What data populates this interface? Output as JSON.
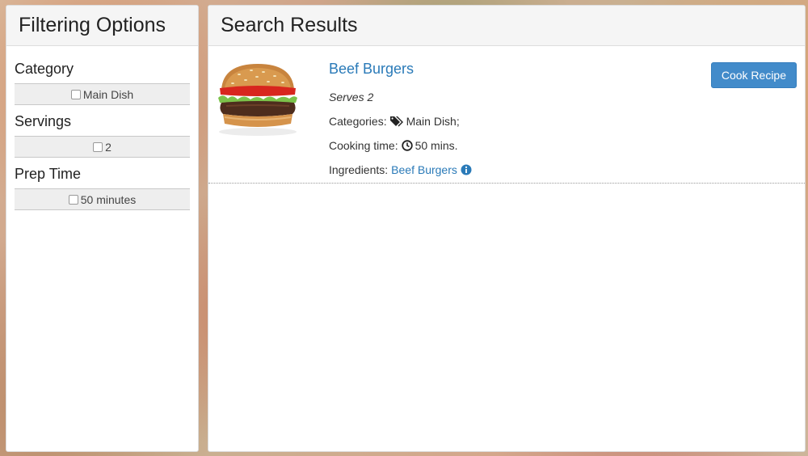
{
  "filters": {
    "title": "Filtering Options",
    "groups": [
      {
        "title": "Category",
        "option": "Main Dish"
      },
      {
        "title": "Servings",
        "option": "2"
      },
      {
        "title": "Prep Time",
        "option": "50 minutes"
      }
    ]
  },
  "results": {
    "title": "Search Results",
    "items": [
      {
        "name": "Beef Burgers",
        "serves": "Serves 2",
        "categories_label": "Categories:",
        "categories_value": "Main Dish;",
        "cooking_label": "Cooking time:",
        "cooking_value": "50 mins.",
        "ingredients_label": "Ingredients:",
        "ingredients_value": "Beef Burgers",
        "button": "Cook Recipe",
        "icons": [
          "tags-icon",
          "clock-icon",
          "info-icon"
        ]
      }
    ]
  },
  "colors": {
    "link": "#2a7ab8",
    "button": "#428bca"
  }
}
